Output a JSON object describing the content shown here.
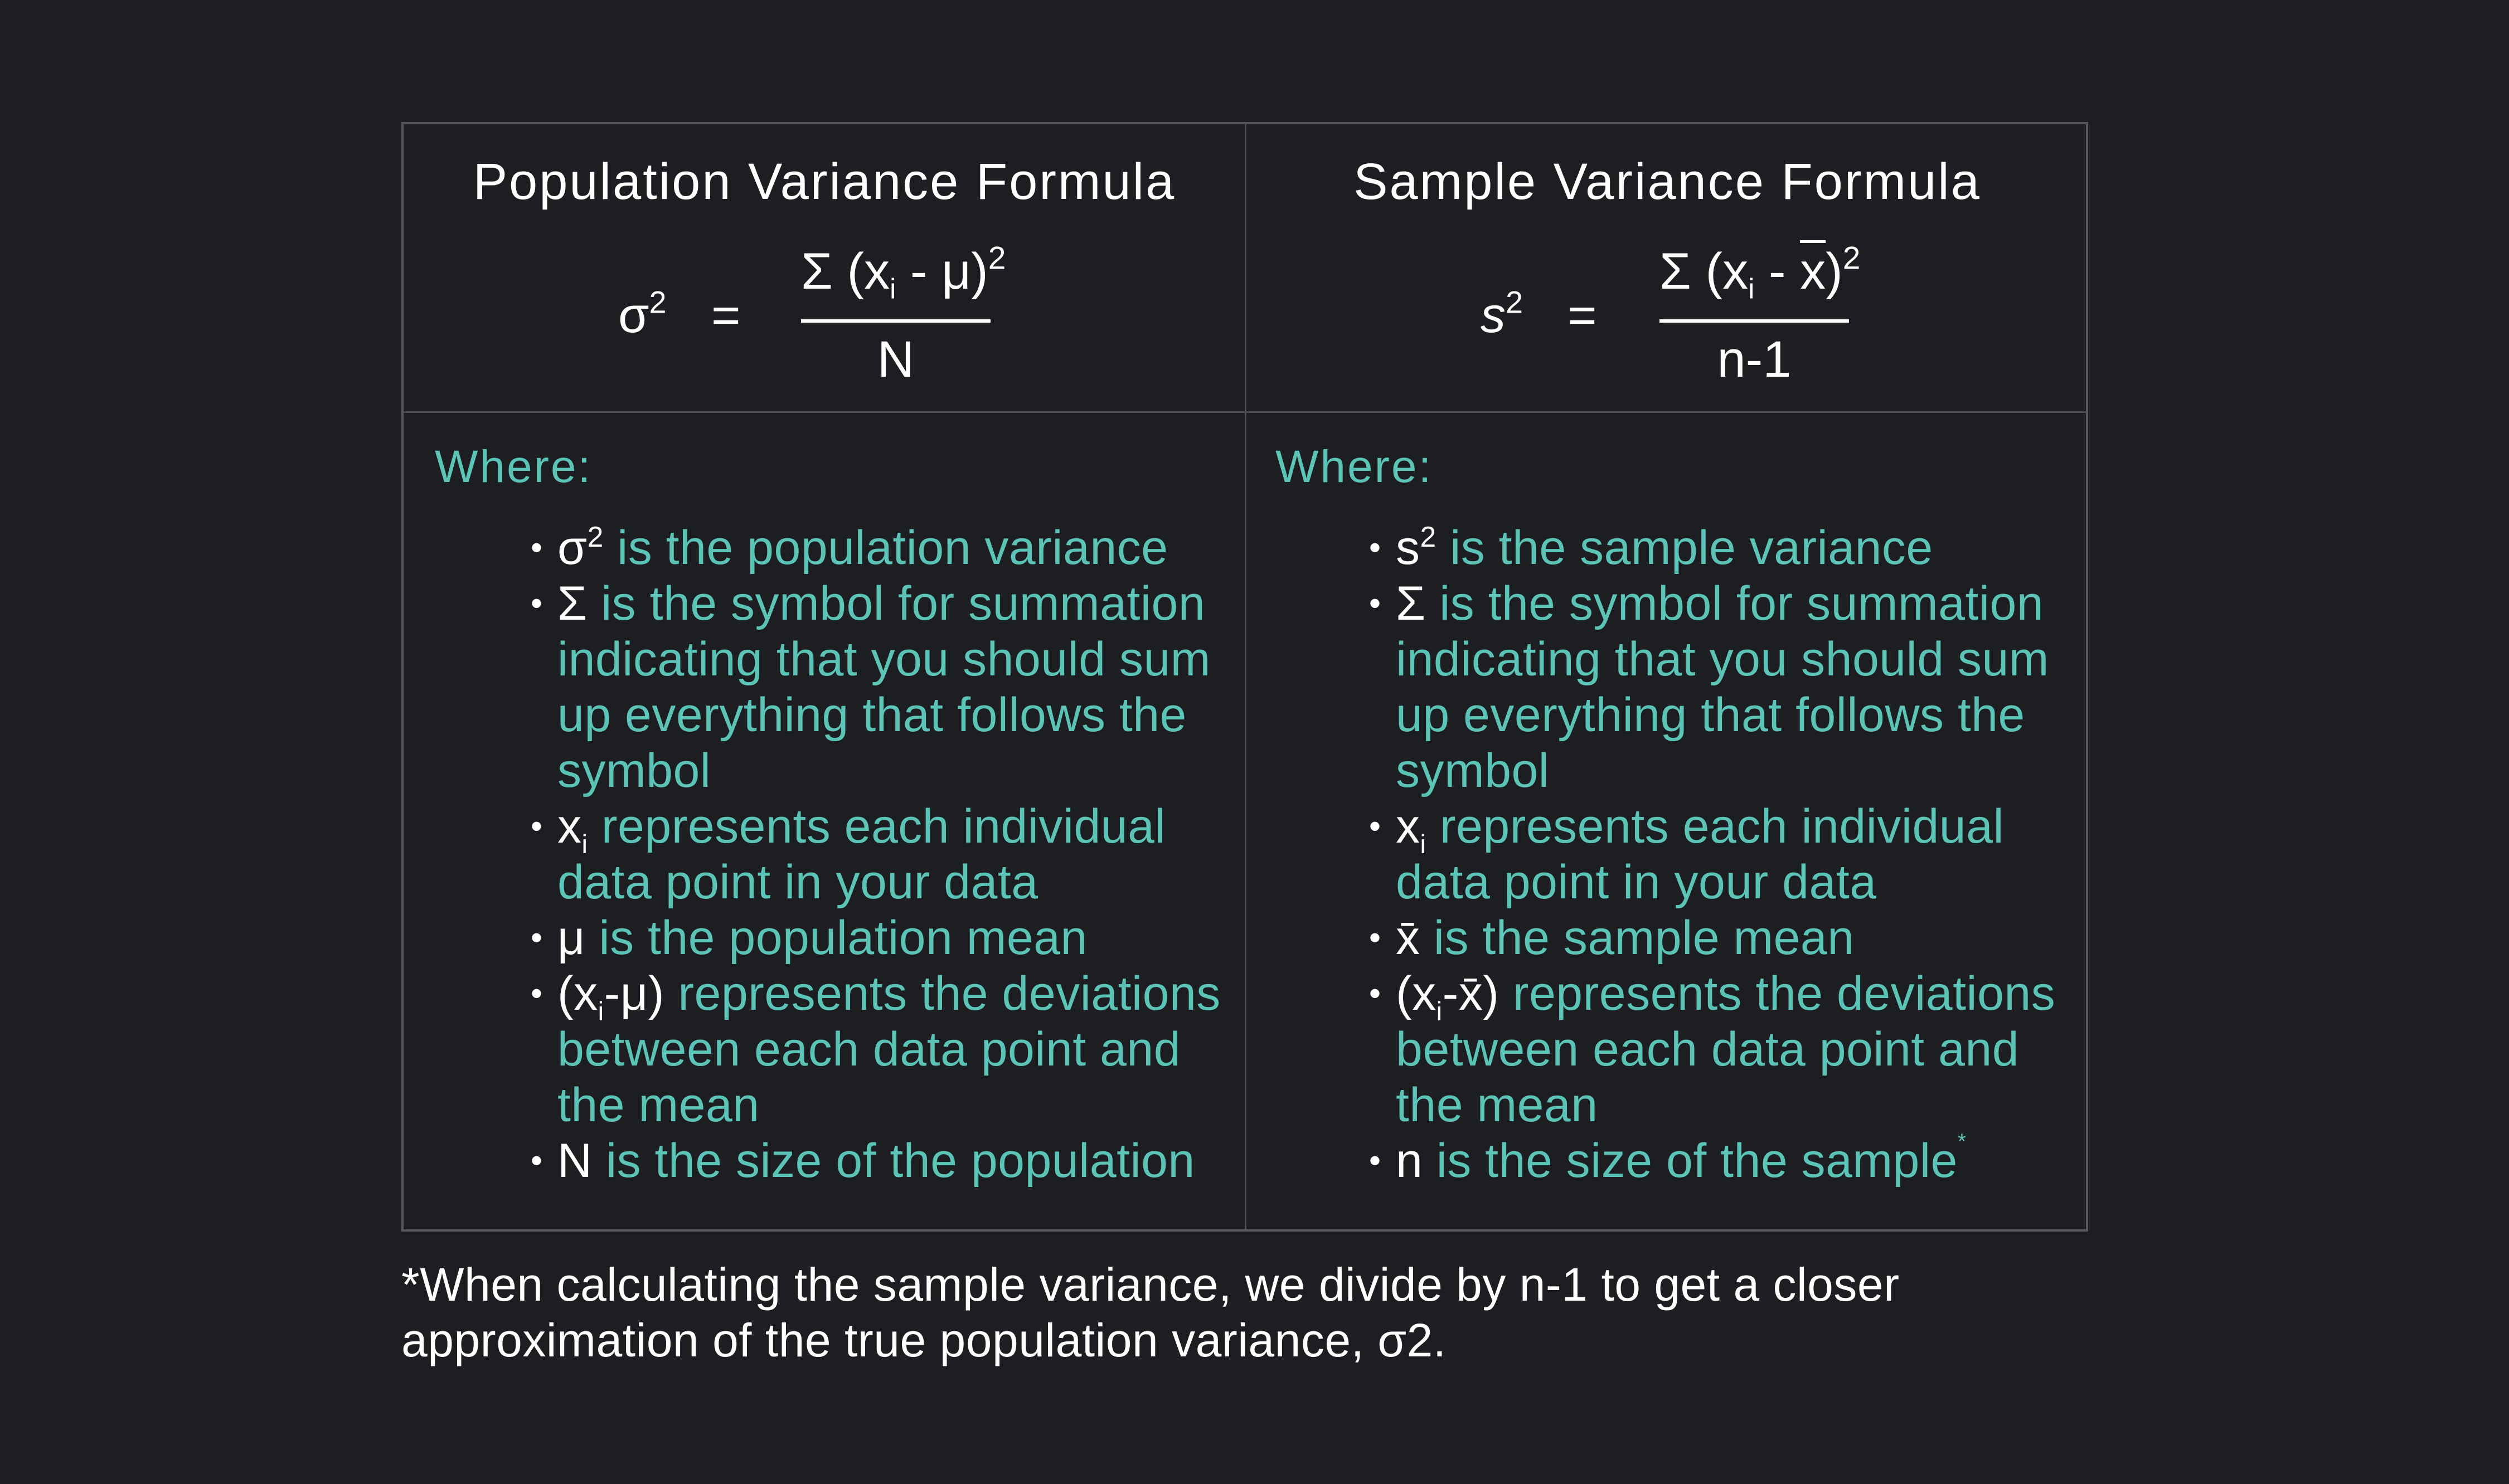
{
  "colors": {
    "background": "#1d1e22",
    "border": "#57585c",
    "accent_teal": "#5bc4b6",
    "text_white": "#ffffff"
  },
  "population": {
    "title": "Population Variance Formula",
    "formula": {
      "lhs_symbol": "σ",
      "lhs_exponent": "2",
      "equals": "=",
      "numerator": {
        "sigma": "Σ",
        "open": "(x",
        "sub": "i",
        "minus": " - ",
        "mean": "μ",
        "close": ")",
        "exponent": "2"
      },
      "denominator": "N"
    },
    "where_label": "Where:",
    "definitions": [
      {
        "term": "σ",
        "term_sup": "2",
        "term_sub": "",
        "term_rest": "",
        "text": " is the population variance"
      },
      {
        "term": "Σ",
        "term_sup": "",
        "term_sub": "",
        "term_rest": "",
        "text": " is the symbol for summation indicating that you should sum up everything that follows the symbol"
      },
      {
        "term": "x",
        "term_sup": "",
        "term_sub": "i",
        "term_rest": "",
        "text": " represents each individual data point in your data"
      },
      {
        "term": "μ",
        "term_sup": "",
        "term_sub": "",
        "term_rest": "",
        "text": " is the population mean"
      },
      {
        "term": "(x",
        "term_sup": "",
        "term_sub": "i",
        "term_rest": "-μ)",
        "text": " represents the deviations between each data point and the mean"
      },
      {
        "term": "N",
        "term_sup": "",
        "term_sub": "",
        "term_rest": "",
        "text": " is the size of the population"
      }
    ]
  },
  "sample": {
    "title": "Sample Variance Formula",
    "formula": {
      "lhs_symbol": "s",
      "lhs_exponent": "2",
      "equals": "=",
      "numerator": {
        "sigma": "Σ",
        "open": "(x",
        "sub": "i",
        "minus": " - ",
        "mean": "x",
        "close": ")",
        "exponent": "2"
      },
      "denominator": "n-1"
    },
    "where_label": "Where:",
    "definitions": [
      {
        "term": "s",
        "term_sup": "2",
        "term_sub": "",
        "term_rest": "",
        "text": " is the sample variance"
      },
      {
        "term": "Σ",
        "term_sup": "",
        "term_sub": "",
        "term_rest": "",
        "text": " is the symbol for summation indicating that you should sum up everything that follows the symbol"
      },
      {
        "term": "x",
        "term_sup": "",
        "term_sub": "i",
        "term_rest": "",
        "text": " represents each individual data point in your data"
      },
      {
        "term": "x̄",
        "term_sup": "",
        "term_sub": "",
        "term_rest": "",
        "text": " is the sample mean"
      },
      {
        "term": "(x",
        "term_sup": "",
        "term_sub": "i",
        "term_rest": "-x̄)",
        "text": " represents the deviations between each data point and the mean"
      },
      {
        "term": "n",
        "term_sup": "",
        "term_sub": "",
        "term_rest": "",
        "text": " is the size of the sample",
        "footnote_marker": "*"
      }
    ]
  },
  "bullet_glyph": "•",
  "footnote": "*When calculating the sample variance, we divide by n-1 to get a closer approximation of the true population variance, σ2."
}
